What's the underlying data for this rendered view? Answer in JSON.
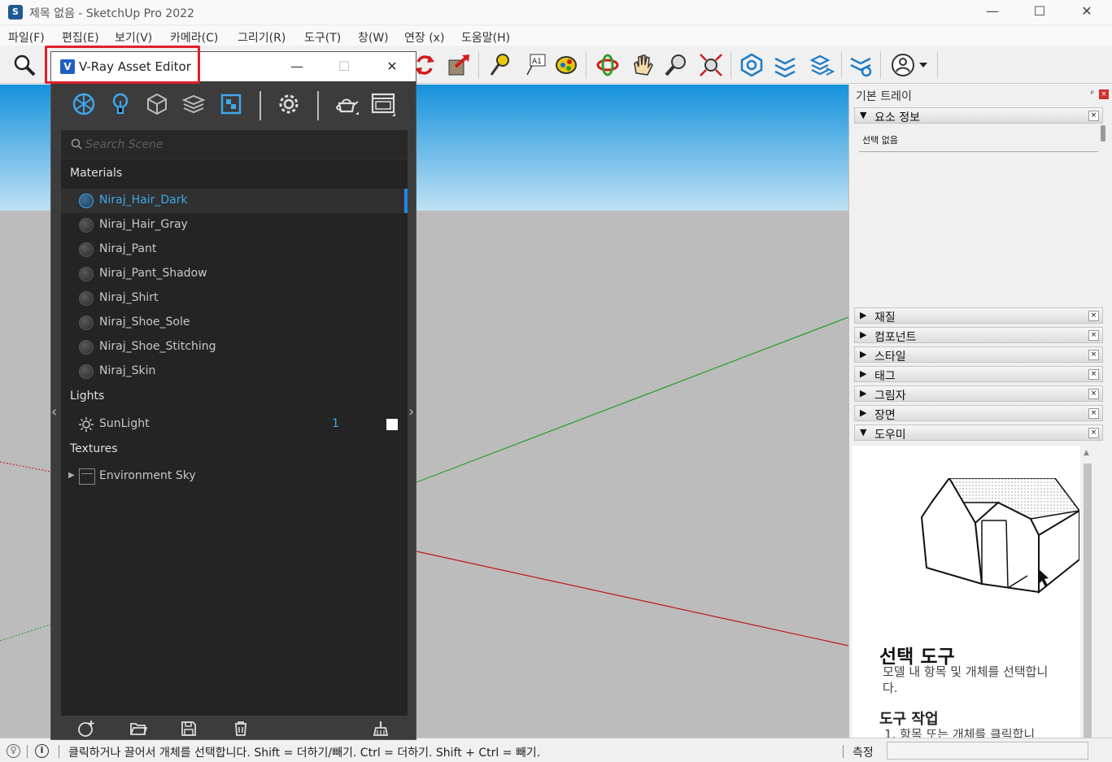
{
  "window": {
    "title": "제목 없음 - SketchUp Pro 2022",
    "minimize": "—",
    "maximize": "☐",
    "close": "✕"
  },
  "menu": [
    "파일(F)",
    "편집(E)",
    "보기(V)",
    "카메라(C)",
    "그리기(R)",
    "도구(T)",
    "창(W)",
    "연장 (x)",
    "도움말(H)"
  ],
  "toolbar": {
    "tools": [
      "zoom-tool-icon",
      "refresh-icon",
      "export-icon",
      "tape-measure-icon",
      "text-icon",
      "paint-bucket-icon",
      "orbit-icon",
      "pan-icon",
      "zoom-icon",
      "zoom-extents-icon",
      "vray-render-icon",
      "vray-interactive-icon",
      "vray-lights-icon",
      "vray-settings-icon",
      "account-icon"
    ]
  },
  "vray": {
    "title": "V-Ray Asset Editor",
    "search_placeholder": "Search Scene",
    "sections": {
      "materials": "Materials",
      "lights": "Lights",
      "textures": "Textures"
    },
    "materials": [
      "Niraj_Hair_Dark",
      "Niraj_Hair_Gray",
      "Niraj_Pant",
      "Niraj_Pant_Shadow",
      "Niraj_Shirt",
      "Niraj_Shoe_Sole",
      "Niraj_Shoe_Stitching",
      "Niraj_Skin"
    ],
    "selected_material": "Niraj_Hair_Dark",
    "lights": [
      {
        "name": "SunLight",
        "count": "1",
        "enabled": true
      }
    ],
    "textures": [
      "Environment Sky"
    ],
    "nav_left": "‹",
    "nav_right": "›",
    "colors": {
      "accent": "#3fa7ea",
      "panel": "#242424",
      "frame": "#3c3c3c"
    }
  },
  "tray": {
    "title": "기본 트레이",
    "pin": "ᵖ",
    "close": "×",
    "entity_info": {
      "label": "요소 정보",
      "body": "선택 없음"
    },
    "panels": [
      "재질",
      "컴포넌트",
      "스타일",
      "태그",
      "그림자",
      "장면"
    ],
    "instructor": {
      "label": "도우미",
      "title": "선택 도구",
      "description": "모델 내 항목 및 개체를 선택합니다.",
      "subtitle": "도구 작업",
      "step": "1. 항목 또는 개체를 클릭합니"
    },
    "expanded_arrow": "▼",
    "collapsed_arrow": "▶"
  },
  "status": {
    "message": "클릭하거나 끌어서 개체를 선택합니다. Shift = 더하기/빼기. Ctrl = 더하기. Shift + Ctrl = 빼기.",
    "measure_label": "측정",
    "measure_value": ""
  }
}
